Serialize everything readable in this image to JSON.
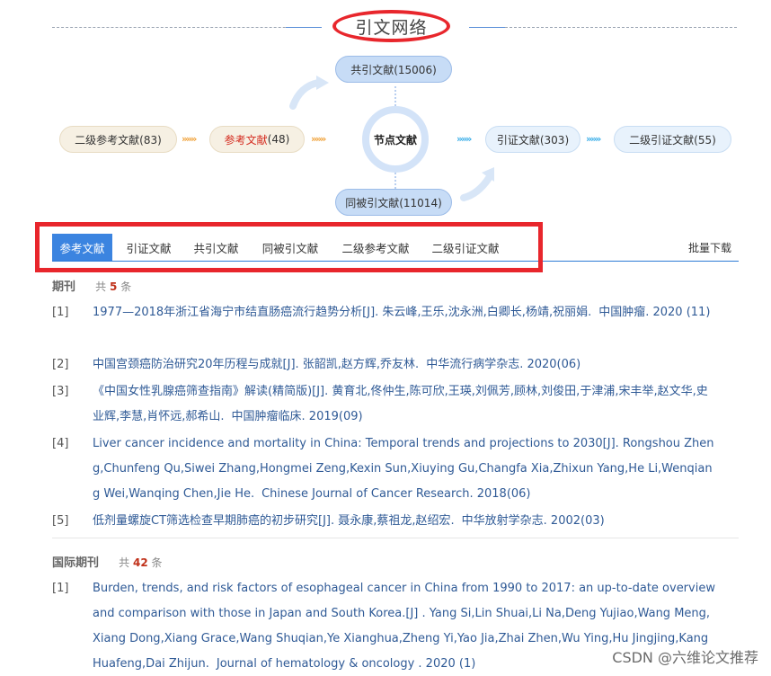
{
  "header": {
    "title": "引文网络"
  },
  "network": {
    "co_citing": "共引文献(15006)",
    "second_refs": "二级参考文献(83)",
    "refs_label": "参考文献",
    "refs_count": "(48)",
    "node": "节点文献",
    "citing": "引证文献(303)",
    "second_citing": "二级引证文献(55)",
    "co_cited": "同被引文献(11014)",
    "arrow_glyph": "»»»"
  },
  "tabs": [
    {
      "label": "参考文献",
      "active": true
    },
    {
      "label": "引证文献",
      "active": false
    },
    {
      "label": "共引文献",
      "active": false
    },
    {
      "label": "同被引文献",
      "active": false
    },
    {
      "label": "二级参考文献",
      "active": false
    },
    {
      "label": "二级引证文献",
      "active": false
    }
  ],
  "batch_download": "批量下载",
  "journals": {
    "name": "期刊",
    "total_prefix": "共",
    "total": "5",
    "total_suffix": "条",
    "items": [
      {
        "idx": "[1]",
        "text": "1977—2018年浙江省海宁市结直肠癌流行趋势分析[J]. 朱云峰,王乐,沈永洲,白卿长,杨靖,祝丽娟.",
        "source": "中国肿瘤. 2020 (11)"
      },
      {
        "idx": "[2]",
        "text": "中国宫颈癌防治研究20年历程与成就[J]. 张韶凯,赵方辉,乔友林.",
        "source": "中华流行病学杂志. 2020(06)"
      },
      {
        "idx": "[3]",
        "text": "《中国女性乳腺癌筛查指南》解读(精简版)[J]. 黄育北,佟仲生,陈可欣,王瑛,刘佩芳,顾林,刘俊田,于津浦,宋丰举,赵文华,史业辉,李慧,肖怀远,郝希山.",
        "source": "中国肿瘤临床. 2019(09)"
      },
      {
        "idx": "[4]",
        "text": "Liver cancer incidence and mortality in China: Temporal trends and projections to 2030[J]. Rongshou Zheng,Chunfeng Qu,Siwei Zhang,Hongmei Zeng,Kexin Sun,Xiuying Gu,Changfa Xia,Zhixun Yang,He Li,Wenqiang Wei,Wanqing Chen,Jie He.",
        "source": "Chinese Journal of Cancer Research. 2018(06)"
      },
      {
        "idx": "[5]",
        "text": "低剂量螺旋CT筛选检查早期肺癌的初步研究[J]. 聂永康,蔡祖龙,赵绍宏.",
        "source": "中华放射学杂志. 2002(03)"
      }
    ]
  },
  "intl_journals": {
    "name": "国际期刊",
    "total_prefix": "共",
    "total": "42",
    "total_suffix": "条",
    "items": [
      {
        "idx": "[1]",
        "text": "Burden, trends, and risk factors of esophageal cancer in China from 1990 to 2017: an up-to-date overview and comparison with those in Japan and South Korea.[J] . Yang Si,Lin Shuai,Li Na,Deng Yujiao,Wang Meng,Xiang Dong,Xiang Grace,Wang Shuqian,Ye Xianghua,Zheng Yi,Yao Jia,Zhai Zhen,Wu Ying,Hu Jingjing,Kang Huafeng,Dai Zhijun.",
        "source": "Journal of hematology & oncology . 2020 (1)"
      }
    ]
  },
  "watermark": "CSDN @六维论文推荐",
  "colors": {
    "accent": "#3b84e0",
    "highlight_border": "#e8262c",
    "link": "#2f5a96"
  }
}
